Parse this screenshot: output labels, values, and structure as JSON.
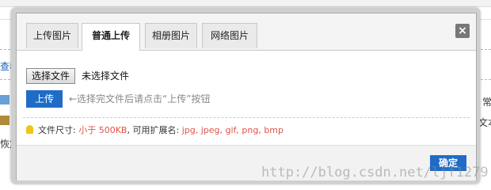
{
  "background": {
    "left_text_1": "查看",
    "left_text_2": "恢复",
    "right_text_1": "常",
    "right_text_2": "文本"
  },
  "dialog": {
    "tabs": [
      {
        "label": "上传图片",
        "active": false
      },
      {
        "label": "普通上传",
        "active": true
      },
      {
        "label": "相册图片",
        "active": false
      },
      {
        "label": "网络图片",
        "active": false
      }
    ],
    "close_label": "×",
    "choose_file_label": "选择文件",
    "file_status": "未选择文件",
    "upload_label": "上传",
    "upload_hint": "←选择完文件后请点击“上传”按钮",
    "info": {
      "size_label": "文件尺寸:",
      "size_value": "小于 500KB",
      "ext_label": ", 可用扩展名:",
      "ext_value": "jpg, jpeg, gif, png, bmp"
    },
    "ok_label": "确定"
  },
  "watermark": "http://blog.csdn.net/ljf1279",
  "colors": {
    "accent": "#1f6cc7",
    "highlight": "#e0534a"
  }
}
